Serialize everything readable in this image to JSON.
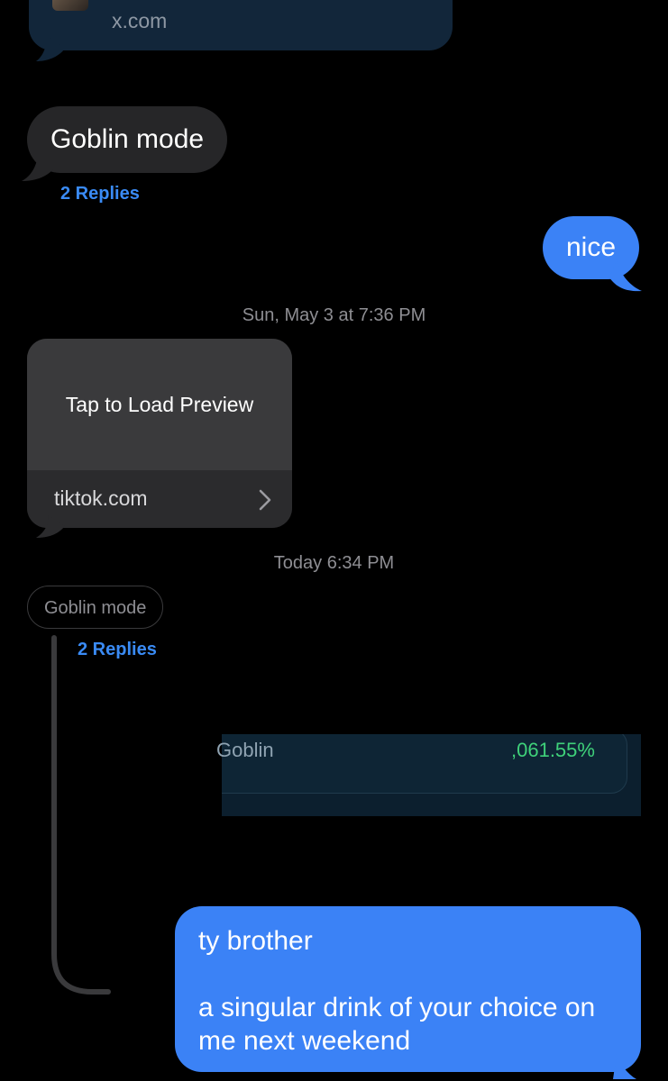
{
  "messages": {
    "top_link": {
      "domain": "x.com"
    },
    "goblin_bubble": {
      "text": "Goblin mode",
      "replies": "2 Replies"
    },
    "nice_bubble": {
      "text": "nice"
    },
    "timestamp_1": {
      "day": "Sun, May 3",
      "at": "at",
      "time": "7:36 PM"
    },
    "tiktok_card": {
      "preview_label": "Tap to Load Preview",
      "domain": "tiktok.com"
    },
    "timestamp_2": {
      "day": "Today",
      "time": "6:34 PM"
    },
    "thread": {
      "quote": "Goblin mode",
      "replies": "2 Replies"
    },
    "embedded_image": {
      "name": "Goblin",
      "percent": ",061.55%"
    },
    "final_bubble": {
      "line1": "ty brother",
      "line2": "a singular drink of your choice on me next weekend"
    }
  },
  "colors": {
    "background": "#000000",
    "sent_bubble": "#3b82f6",
    "received_bubble": "#262628",
    "link_accent": "#3a8bf5",
    "timestamp_gray": "#8e8e93",
    "percent_green": "#3fd17a"
  }
}
